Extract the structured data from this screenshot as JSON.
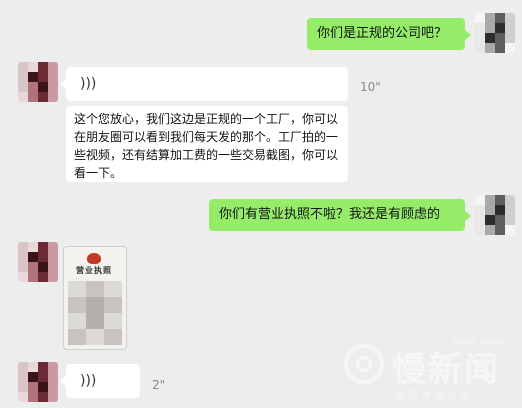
{
  "messages": {
    "m1": {
      "text": "你们是正规的公司吧？"
    },
    "m2": {
      "voice_icon": "voice-wave-icon",
      "duration": "10\"",
      "transcript": "这个您放心，我们这边是正规的一个工厂，你可以在朋友圈可以看到我们每天发的那个。工厂拍的一些视频，还有结算加工费的一些交易截图，你可以看一下。"
    },
    "m3": {
      "text": "你们有营业执照不啦？我还是有顾虑的"
    },
    "m4": {
      "image_title": "营业执照"
    },
    "m5": {
      "voice_icon": "voice-wave-icon",
      "duration": "2\""
    }
  },
  "watermark": {
    "name": "慢新闻",
    "en": "SLOW NEWS",
    "sub": "重庆晚报出品"
  },
  "colors": {
    "background": "#ededed",
    "sent_bubble": "#95ec69",
    "received_bubble": "#ffffff"
  }
}
